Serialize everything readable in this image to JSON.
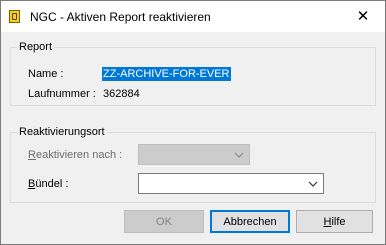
{
  "window": {
    "title": "NGC - Aktiven Report reaktivieren",
    "close_symbol": "✕"
  },
  "report_group": {
    "title": "Report",
    "name_label": "Name :",
    "name_value": "ZZ-ARCHIVE-FOR-EVER",
    "number_label": "Laufnummer :",
    "number_value": "362884"
  },
  "reactivation_group": {
    "title": "Reaktivierungsort",
    "reactivate_label_first": "R",
    "reactivate_label_rest": "eaktivieren nach :",
    "reactivate_value": "",
    "bundle_label_first": "B",
    "bundle_label_rest": "ündel :",
    "bundle_value": ""
  },
  "buttons": {
    "ok": "OK",
    "cancel": "Abbrechen",
    "help_first": "H",
    "help_rest": "ilfe"
  },
  "colors": {
    "selection": "#0078d7",
    "dialog_bg": "#f0f0f0",
    "default_button_border": "#0078d7"
  },
  "icons": {
    "app": "report-app-icon",
    "close": "close-icon",
    "dropdown": "chevron-down-icon"
  }
}
